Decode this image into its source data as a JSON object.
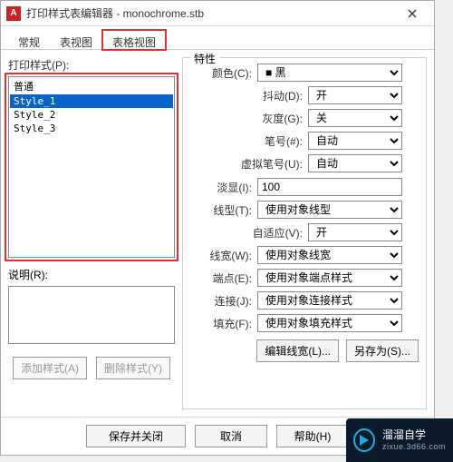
{
  "window": {
    "app_icon": "A",
    "title": "打印样式表编辑器 - monochrome.stb"
  },
  "tabs": [
    "常规",
    "表视图",
    "表格视图"
  ],
  "active_tab": 2,
  "left": {
    "styles_label": "打印样式(P):",
    "styles": [
      "普通",
      "Style_1",
      "Style_2",
      "Style_3"
    ],
    "selected_index": 1,
    "desc_label": "说明(R):",
    "add_btn": "添加样式(A)",
    "del_btn": "删除样式(Y)"
  },
  "right": {
    "group_title": "特性",
    "rows": {
      "color": {
        "label": "颜色(C):",
        "value": "黑"
      },
      "dither": {
        "label": "抖动(D):",
        "value": "开"
      },
      "gray": {
        "label": "灰度(G):",
        "value": "关"
      },
      "pen": {
        "label": "笔号(#):",
        "value": "自动"
      },
      "vpen": {
        "label": "虚拟笔号(U):",
        "value": "自动"
      },
      "screen": {
        "label": "淡显(I):",
        "value": "100"
      },
      "linetype": {
        "label": "线型(T):",
        "value": "使用对象线型"
      },
      "adapt": {
        "label": "自适应(V):",
        "value": "开"
      },
      "lweight": {
        "label": "线宽(W):",
        "value": "使用对象线宽"
      },
      "endcap": {
        "label": "端点(E):",
        "value": "使用对象端点样式"
      },
      "join": {
        "label": "连接(J):",
        "value": "使用对象连接样式"
      },
      "fill": {
        "label": "填充(F):",
        "value": "使用对象填充样式"
      }
    },
    "edit_lw_btn": "编辑线宽(L)...",
    "saveas_btn": "另存为(S)..."
  },
  "footer": {
    "save_close": "保存并关闭",
    "cancel": "取消",
    "help": "帮助(H)"
  },
  "watermark": {
    "brand": "溜溜自学",
    "sub": "zixue.3d66.com"
  }
}
